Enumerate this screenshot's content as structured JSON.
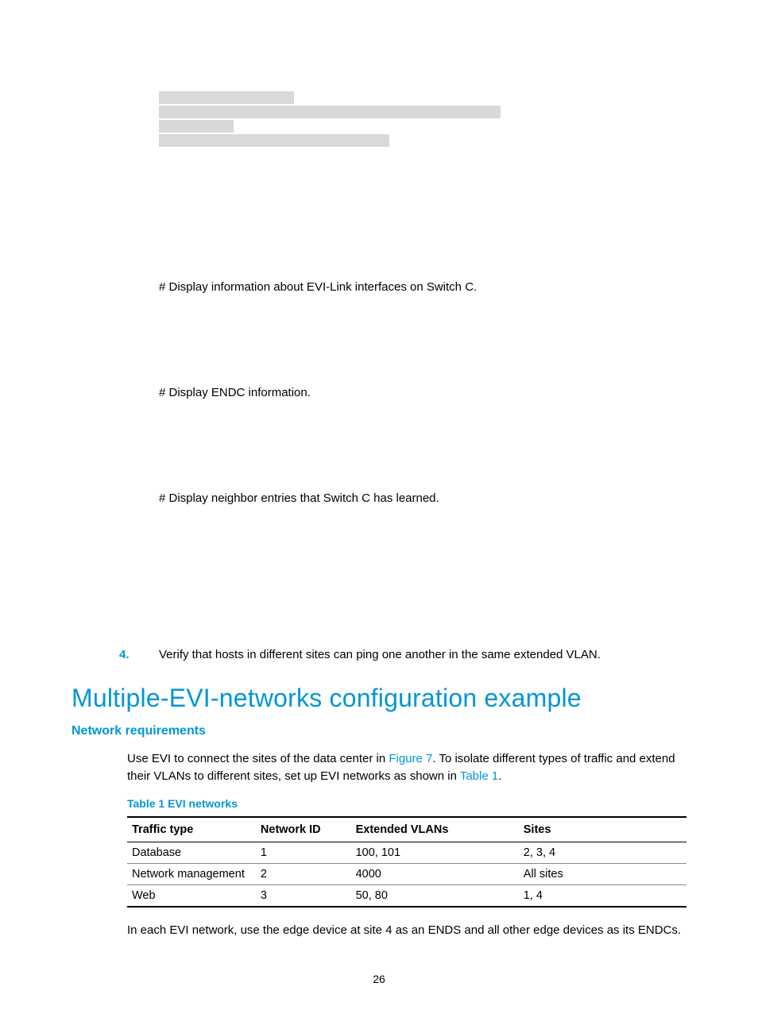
{
  "commands": {
    "cmd1": "# Display information about EVI-Link interfaces on Switch C.",
    "cmd2": "# Display ENDC information.",
    "cmd3": "# Display neighbor entries that Switch C has learned."
  },
  "step": {
    "num": "4.",
    "text": "Verify that hosts in different sites can ping one another in the same extended VLAN."
  },
  "section_heading": "Multiple-EVI-networks configuration example",
  "subsection": "Network requirements",
  "intro_parts": {
    "p1": "Use EVI to connect the sites of the data center in ",
    "link1": "Figure 7",
    "p2": ". To isolate different types of traffic and extend their VLANs to different sites, set up EVI networks as shown in ",
    "link2": "Table 1",
    "p3": "."
  },
  "table": {
    "caption": "Table 1 EVI networks",
    "headers": {
      "traffic": "Traffic type",
      "netid": "Network ID",
      "vlans": "Extended VLANs",
      "sites": "Sites"
    },
    "rows": [
      {
        "traffic": "Database",
        "netid": "1",
        "vlans": "100, 101",
        "sites": "2, 3, 4"
      },
      {
        "traffic": "Network management",
        "netid": "2",
        "vlans": "4000",
        "sites": "All sites"
      },
      {
        "traffic": "Web",
        "netid": "3",
        "vlans": "50, 80",
        "sites": "1, 4"
      }
    ]
  },
  "footnote": "In each EVI network, use the edge device at site 4 as an ENDS and all other edge devices as its ENDCs.",
  "page_number": "26"
}
